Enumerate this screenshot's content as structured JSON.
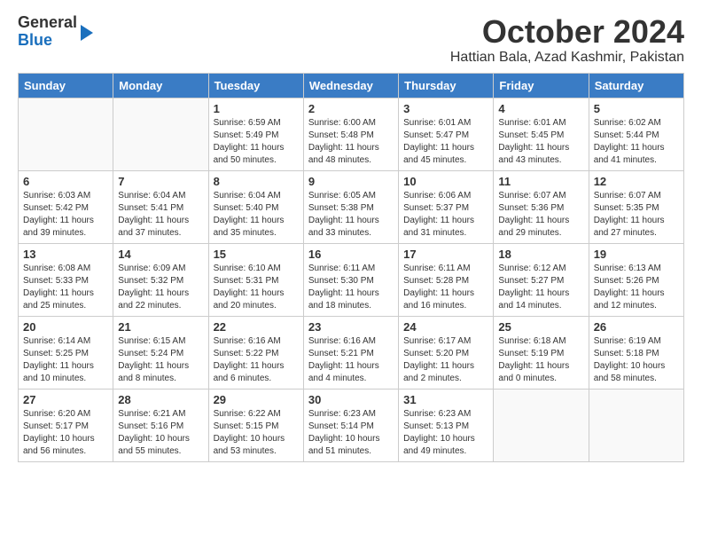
{
  "header": {
    "logo_line1": "General",
    "logo_line2": "Blue",
    "month_title": "October 2024",
    "location": "Hattian Bala, Azad Kashmir, Pakistan"
  },
  "weekdays": [
    "Sunday",
    "Monday",
    "Tuesday",
    "Wednesday",
    "Thursday",
    "Friday",
    "Saturday"
  ],
  "weeks": [
    [
      {
        "day": "",
        "empty": true
      },
      {
        "day": "",
        "empty": true
      },
      {
        "day": "1",
        "sunrise": "6:59 AM",
        "sunset": "5:49 PM",
        "daylight": "11 hours and 50 minutes."
      },
      {
        "day": "2",
        "sunrise": "6:00 AM",
        "sunset": "5:48 PM",
        "daylight": "11 hours and 48 minutes."
      },
      {
        "day": "3",
        "sunrise": "6:01 AM",
        "sunset": "5:47 PM",
        "daylight": "11 hours and 45 minutes."
      },
      {
        "day": "4",
        "sunrise": "6:01 AM",
        "sunset": "5:45 PM",
        "daylight": "11 hours and 43 minutes."
      },
      {
        "day": "5",
        "sunrise": "6:02 AM",
        "sunset": "5:44 PM",
        "daylight": "11 hours and 41 minutes."
      }
    ],
    [
      {
        "day": "6",
        "sunrise": "6:03 AM",
        "sunset": "5:42 PM",
        "daylight": "11 hours and 39 minutes."
      },
      {
        "day": "7",
        "sunrise": "6:04 AM",
        "sunset": "5:41 PM",
        "daylight": "11 hours and 37 minutes."
      },
      {
        "day": "8",
        "sunrise": "6:04 AM",
        "sunset": "5:40 PM",
        "daylight": "11 hours and 35 minutes."
      },
      {
        "day": "9",
        "sunrise": "6:05 AM",
        "sunset": "5:38 PM",
        "daylight": "11 hours and 33 minutes."
      },
      {
        "day": "10",
        "sunrise": "6:06 AM",
        "sunset": "5:37 PM",
        "daylight": "11 hours and 31 minutes."
      },
      {
        "day": "11",
        "sunrise": "6:07 AM",
        "sunset": "5:36 PM",
        "daylight": "11 hours and 29 minutes."
      },
      {
        "day": "12",
        "sunrise": "6:07 AM",
        "sunset": "5:35 PM",
        "daylight": "11 hours and 27 minutes."
      }
    ],
    [
      {
        "day": "13",
        "sunrise": "6:08 AM",
        "sunset": "5:33 PM",
        "daylight": "11 hours and 25 minutes."
      },
      {
        "day": "14",
        "sunrise": "6:09 AM",
        "sunset": "5:32 PM",
        "daylight": "11 hours and 22 minutes."
      },
      {
        "day": "15",
        "sunrise": "6:10 AM",
        "sunset": "5:31 PM",
        "daylight": "11 hours and 20 minutes."
      },
      {
        "day": "16",
        "sunrise": "6:11 AM",
        "sunset": "5:30 PM",
        "daylight": "11 hours and 18 minutes."
      },
      {
        "day": "17",
        "sunrise": "6:11 AM",
        "sunset": "5:28 PM",
        "daylight": "11 hours and 16 minutes."
      },
      {
        "day": "18",
        "sunrise": "6:12 AM",
        "sunset": "5:27 PM",
        "daylight": "11 hours and 14 minutes."
      },
      {
        "day": "19",
        "sunrise": "6:13 AM",
        "sunset": "5:26 PM",
        "daylight": "11 hours and 12 minutes."
      }
    ],
    [
      {
        "day": "20",
        "sunrise": "6:14 AM",
        "sunset": "5:25 PM",
        "daylight": "11 hours and 10 minutes."
      },
      {
        "day": "21",
        "sunrise": "6:15 AM",
        "sunset": "5:24 PM",
        "daylight": "11 hours and 8 minutes."
      },
      {
        "day": "22",
        "sunrise": "6:16 AM",
        "sunset": "5:22 PM",
        "daylight": "11 hours and 6 minutes."
      },
      {
        "day": "23",
        "sunrise": "6:16 AM",
        "sunset": "5:21 PM",
        "daylight": "11 hours and 4 minutes."
      },
      {
        "day": "24",
        "sunrise": "6:17 AM",
        "sunset": "5:20 PM",
        "daylight": "11 hours and 2 minutes."
      },
      {
        "day": "25",
        "sunrise": "6:18 AM",
        "sunset": "5:19 PM",
        "daylight": "11 hours and 0 minutes."
      },
      {
        "day": "26",
        "sunrise": "6:19 AM",
        "sunset": "5:18 PM",
        "daylight": "10 hours and 58 minutes."
      }
    ],
    [
      {
        "day": "27",
        "sunrise": "6:20 AM",
        "sunset": "5:17 PM",
        "daylight": "10 hours and 56 minutes."
      },
      {
        "day": "28",
        "sunrise": "6:21 AM",
        "sunset": "5:16 PM",
        "daylight": "10 hours and 55 minutes."
      },
      {
        "day": "29",
        "sunrise": "6:22 AM",
        "sunset": "5:15 PM",
        "daylight": "10 hours and 53 minutes."
      },
      {
        "day": "30",
        "sunrise": "6:23 AM",
        "sunset": "5:14 PM",
        "daylight": "10 hours and 51 minutes."
      },
      {
        "day": "31",
        "sunrise": "6:23 AM",
        "sunset": "5:13 PM",
        "daylight": "10 hours and 49 minutes."
      },
      {
        "day": "",
        "empty": true
      },
      {
        "day": "",
        "empty": true
      }
    ]
  ]
}
